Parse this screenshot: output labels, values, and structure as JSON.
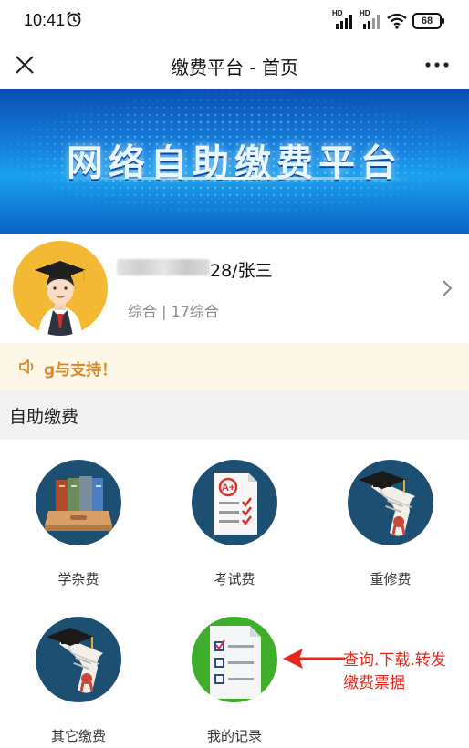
{
  "status_bar": {
    "time": "10:41",
    "signal_labels": [
      "HD",
      "HD"
    ],
    "battery": "68"
  },
  "nav": {
    "title": "缴费平台 - 首页",
    "close_icon": "close-icon",
    "more_icon": "more-icon"
  },
  "banner": {
    "text": "网络自助缴费平台"
  },
  "profile": {
    "name_suffix": "28/张三",
    "subtitle": "综合 | 17综合"
  },
  "notice": {
    "text": "ɡ与支持！"
  },
  "section": {
    "title": "自助缴费"
  },
  "grid": {
    "items": [
      {
        "label": "学杂费",
        "icon": "books-icon"
      },
      {
        "label": "考试费",
        "icon": "exam-paper-icon"
      },
      {
        "label": "重修费",
        "icon": "diploma-icon"
      },
      {
        "label": "其它缴费",
        "icon": "diploma-icon"
      },
      {
        "label": "我的记录",
        "icon": "checklist-icon"
      }
    ]
  },
  "annotation": {
    "line1": "查询.下载.转发",
    "line2": "缴费票据"
  },
  "colors": {
    "accent_red": "#e8261a",
    "notice_orange": "#d88a2a",
    "icon_navy": "#1d4f73",
    "record_green": "#3fae2b",
    "avatar_yellow": "#f4b934"
  }
}
